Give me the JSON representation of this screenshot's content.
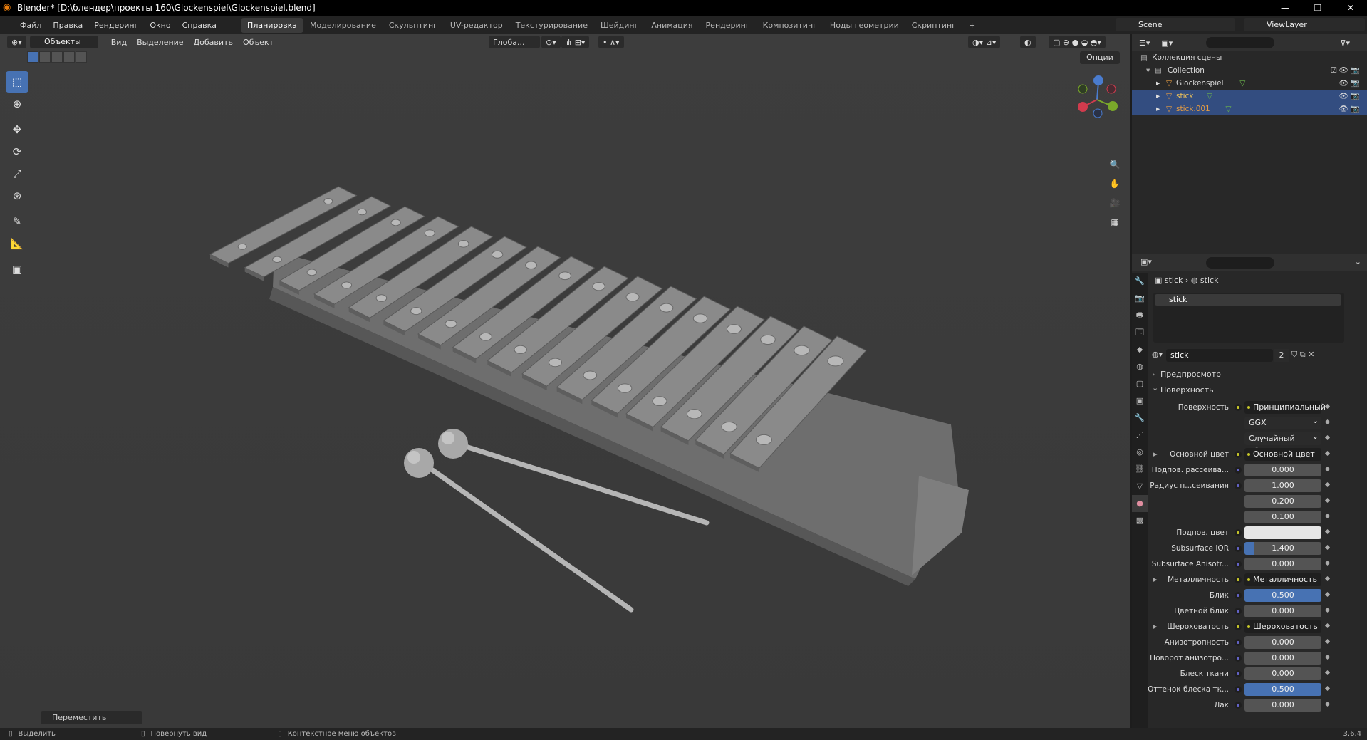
{
  "title": "Blender* [D:\\блендер\\проекты 160\\Glockenspiel\\Glockenspiel.blend]",
  "menu": [
    "Файл",
    "Правка",
    "Рендеринг",
    "Окно",
    "Справка"
  ],
  "workspaces": [
    "Планировка",
    "Моделирование",
    "Скульптинг",
    "UV-редактор",
    "Текстурирование",
    "Шейдинг",
    "Анимация",
    "Рендеринг",
    "Композитинг",
    "Ноды геометрии",
    "Скриптинг",
    "+"
  ],
  "active_workspace": 0,
  "scene": "Scene",
  "view_layer": "ViewLayer",
  "viewport": {
    "mode": "Объекты",
    "menus": [
      "Вид",
      "Выделение",
      "Добавить",
      "Объект"
    ],
    "orientation": "Глоба...",
    "options": "Опции",
    "operator_panel": "Переместить"
  },
  "outliner": {
    "scene_collection": "Коллекция сцены",
    "collection": "Collection",
    "objects": [
      {
        "name": "Glockenspiel",
        "selected": false,
        "color": "#d8d8d8"
      },
      {
        "name": "stick",
        "selected": true,
        "color": "#f0c35a"
      },
      {
        "name": "stick.001",
        "selected": true,
        "color": "#e39b43"
      }
    ]
  },
  "properties": {
    "crumb_object": "stick",
    "crumb_material": "stick",
    "slot": "stick",
    "material_name": "stick",
    "users": "2",
    "sections": {
      "preview": "Предпросмотр",
      "surface": "Поверхность"
    },
    "rows": [
      {
        "label": "Поверхность",
        "value": "Принципиальный BSDF",
        "kind": "node"
      },
      {
        "label": "",
        "value": "GGX",
        "kind": "drop"
      },
      {
        "label": "",
        "value": "Случайный обход",
        "kind": "drop"
      },
      {
        "label": "Основной цвет",
        "value": "Основной цвет",
        "kind": "node",
        "expand": true
      },
      {
        "label": "Подпов. рассеива...",
        "value": "0.000",
        "kind": "num",
        "fill": 0
      },
      {
        "label": "Радиус п...сеивания",
        "value": "1.000",
        "kind": "num",
        "fill": 0
      },
      {
        "label": "",
        "value": "0.200",
        "kind": "num",
        "fill": 0
      },
      {
        "label": "",
        "value": "0.100",
        "kind": "num",
        "fill": 0
      },
      {
        "label": "Подпов. цвет",
        "value": "",
        "kind": "white"
      },
      {
        "label": "Subsurface IOR",
        "value": "1.400",
        "kind": "num",
        "fill": 0.12
      },
      {
        "label": "Subsurface Anisotr...",
        "value": "0.000",
        "kind": "num",
        "fill": 0
      },
      {
        "label": "Металличность",
        "value": "Металличность",
        "kind": "node",
        "expand": true
      },
      {
        "label": "Блик",
        "value": "0.500",
        "kind": "num",
        "fill": 1
      },
      {
        "label": "Цветной блик",
        "value": "0.000",
        "kind": "num",
        "fill": 0
      },
      {
        "label": "Шероховатость",
        "value": "Шероховатость",
        "kind": "node",
        "expand": true
      },
      {
        "label": "Анизотропность",
        "value": "0.000",
        "kind": "num",
        "fill": 0
      },
      {
        "label": "Поворот анизотро...",
        "value": "0.000",
        "kind": "num",
        "fill": 0
      },
      {
        "label": "Блеск ткани",
        "value": "0.000",
        "kind": "num",
        "fill": 0
      },
      {
        "label": "Оттенок блеска тк...",
        "value": "0.500",
        "kind": "num",
        "fill": 1
      },
      {
        "label": "Лак",
        "value": "0.000",
        "kind": "num",
        "fill": 0
      }
    ]
  },
  "status": {
    "select": "Выделить",
    "rotate": "Повернуть вид",
    "context": "Контекстное меню объектов",
    "version": "3.6.4"
  }
}
